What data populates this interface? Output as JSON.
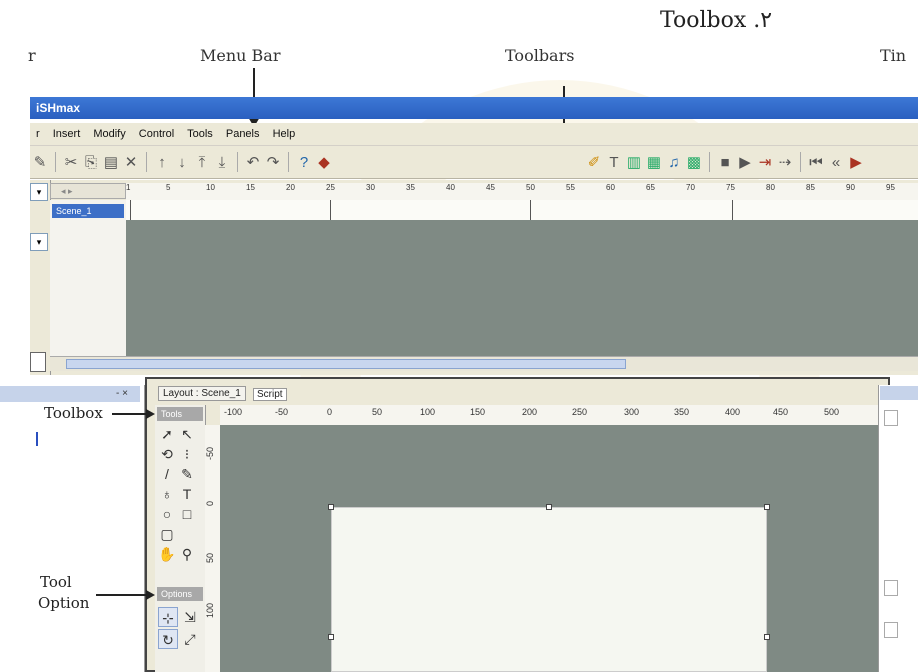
{
  "heading": {
    "text": "Toolbox .٢"
  },
  "callouts": {
    "left_fragment": "r",
    "menu_bar": "Menu Bar",
    "toolbars": "Toolbars",
    "right_fragment": "Tin",
    "toolbox": "Toolbox",
    "tool_option_line1": "Tool",
    "tool_option_line2": "Option"
  },
  "app": {
    "title": "iSHmax",
    "menu": [
      "Insert",
      "Modify",
      "Control",
      "Tools",
      "Panels",
      "Help"
    ],
    "menu_first_fragment": "r"
  },
  "timeline": {
    "scene_name": "Scene_1",
    "ruler_ticks": [
      "1",
      "5",
      "10",
      "15",
      "20",
      "25",
      "30",
      "35",
      "40",
      "45",
      "50",
      "55",
      "60",
      "65",
      "70",
      "75",
      "80",
      "85",
      "90",
      "95"
    ]
  },
  "layout": {
    "tab_label": "Layout : Scene_1",
    "script_tab": "Script",
    "tools_header": "Tools",
    "options_header": "Options",
    "hruler_ticks": [
      "-100",
      "-50",
      "0",
      "50",
      "100",
      "150",
      "200",
      "250",
      "300",
      "350",
      "400",
      "450",
      "500"
    ],
    "vruler_ticks": [
      "-50",
      "0",
      "50",
      "100"
    ]
  },
  "colors": {
    "titlebar": "#2a5fc0",
    "workspace_gray": "#7f8a84",
    "stage": "#f5f7f1",
    "selection": "#3d6fc7"
  }
}
